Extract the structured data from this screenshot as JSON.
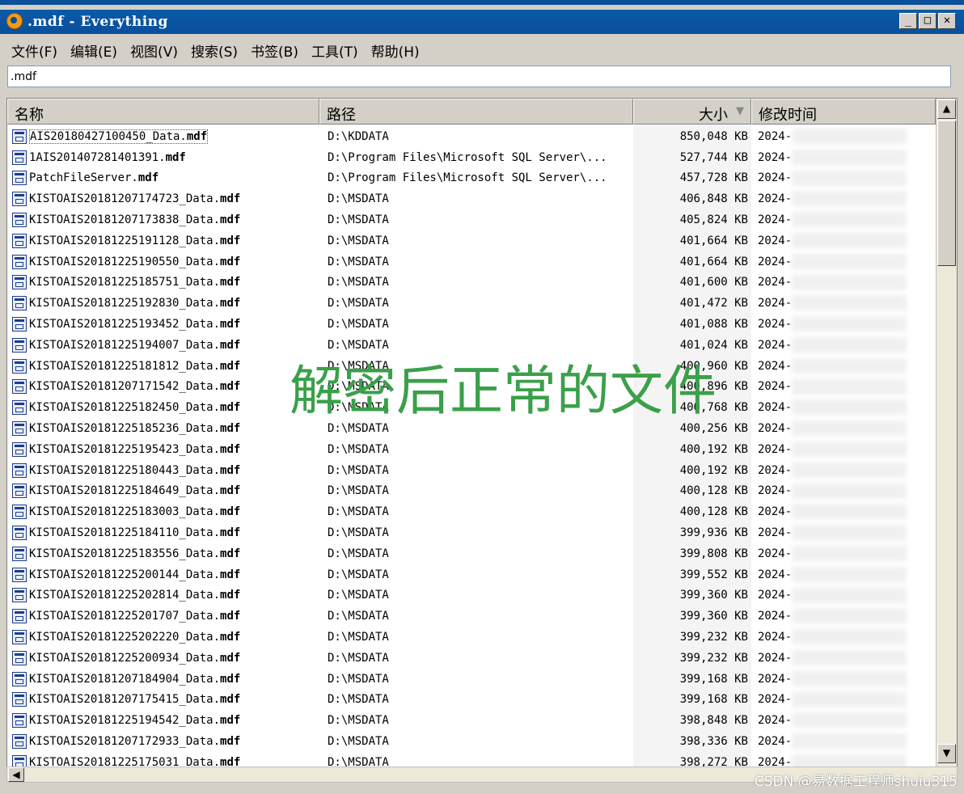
{
  "window": {
    "title": ".mdf - Everything",
    "buttons": {
      "minimize": "_",
      "maximize": "□",
      "close": "✕"
    }
  },
  "menu": [
    "文件(F)",
    "编辑(E)",
    "视图(V)",
    "搜索(S)",
    "书签(B)",
    "工具(T)",
    "帮助(H)"
  ],
  "search": {
    "value": ".mdf"
  },
  "columns": {
    "name": "名称",
    "path": "路径",
    "size": "大小",
    "modified": "修改时间"
  },
  "rows": [
    {
      "base": "AIS20180427100450_Data.",
      "ext": "mdf",
      "path": "D:\\KDDATA",
      "size": "850,048 KB",
      "date": "2024-"
    },
    {
      "base": "1AIS201407281401391.",
      "ext": "mdf",
      "path": "D:\\Program Files\\Microsoft SQL Server\\...",
      "size": "527,744 KB",
      "date": "2024-"
    },
    {
      "base": "PatchFileServer.",
      "ext": "mdf",
      "path": "D:\\Program Files\\Microsoft SQL Server\\...",
      "size": "457,728 KB",
      "date": "2024-"
    },
    {
      "base": "KISTOAIS20181207174723_Data.",
      "ext": "mdf",
      "path": "D:\\MSDATA",
      "size": "406,848 KB",
      "date": "2024-"
    },
    {
      "base": "KISTOAIS20181207173838_Data.",
      "ext": "mdf",
      "path": "D:\\MSDATA",
      "size": "405,824 KB",
      "date": "2024-"
    },
    {
      "base": "KISTOAIS20181225191128_Data.",
      "ext": "mdf",
      "path": "D:\\MSDATA",
      "size": "401,664 KB",
      "date": "2024-"
    },
    {
      "base": "KISTOAIS20181225190550_Data.",
      "ext": "mdf",
      "path": "D:\\MSDATA",
      "size": "401,664 KB",
      "date": "2024-"
    },
    {
      "base": "KISTOAIS20181225185751_Data.",
      "ext": "mdf",
      "path": "D:\\MSDATA",
      "size": "401,600 KB",
      "date": "2024-"
    },
    {
      "base": "KISTOAIS20181225192830_Data.",
      "ext": "mdf",
      "path": "D:\\MSDATA",
      "size": "401,472 KB",
      "date": "2024-"
    },
    {
      "base": "KISTOAIS20181225193452_Data.",
      "ext": "mdf",
      "path": "D:\\MSDATA",
      "size": "401,088 KB",
      "date": "2024-"
    },
    {
      "base": "KISTOAIS20181225194007_Data.",
      "ext": "mdf",
      "path": "D:\\MSDATA",
      "size": "401,024 KB",
      "date": "2024-"
    },
    {
      "base": "KISTOAIS20181225181812_Data.",
      "ext": "mdf",
      "path": "D:\\MSDATA",
      "size": "400,960 KB",
      "date": "2024-"
    },
    {
      "base": "KISTOAIS20181207171542_Data.",
      "ext": "mdf",
      "path": "D:\\MSDATA",
      "size": "400,896 KB",
      "date": "2024-"
    },
    {
      "base": "KISTOAIS20181225182450_Data.",
      "ext": "mdf",
      "path": "D:\\MSDATA",
      "size": "400,768 KB",
      "date": "2024-"
    },
    {
      "base": "KISTOAIS20181225185236_Data.",
      "ext": "mdf",
      "path": "D:\\MSDATA",
      "size": "400,256 KB",
      "date": "2024-"
    },
    {
      "base": "KISTOAIS20181225195423_Data.",
      "ext": "mdf",
      "path": "D:\\MSDATA",
      "size": "400,192 KB",
      "date": "2024-"
    },
    {
      "base": "KISTOAIS20181225180443_Data.",
      "ext": "mdf",
      "path": "D:\\MSDATA",
      "size": "400,192 KB",
      "date": "2024-"
    },
    {
      "base": "KISTOAIS20181225184649_Data.",
      "ext": "mdf",
      "path": "D:\\MSDATA",
      "size": "400,128 KB",
      "date": "2024-"
    },
    {
      "base": "KISTOAIS20181225183003_Data.",
      "ext": "mdf",
      "path": "D:\\MSDATA",
      "size": "400,128 KB",
      "date": "2024-"
    },
    {
      "base": "KISTOAIS20181225184110_Data.",
      "ext": "mdf",
      "path": "D:\\MSDATA",
      "size": "399,936 KB",
      "date": "2024-"
    },
    {
      "base": "KISTOAIS20181225183556_Data.",
      "ext": "mdf",
      "path": "D:\\MSDATA",
      "size": "399,808 KB",
      "date": "2024-"
    },
    {
      "base": "KISTOAIS20181225200144_Data.",
      "ext": "mdf",
      "path": "D:\\MSDATA",
      "size": "399,552 KB",
      "date": "2024-"
    },
    {
      "base": "KISTOAIS20181225202814_Data.",
      "ext": "mdf",
      "path": "D:\\MSDATA",
      "size": "399,360 KB",
      "date": "2024-"
    },
    {
      "base": "KISTOAIS20181225201707_Data.",
      "ext": "mdf",
      "path": "D:\\MSDATA",
      "size": "399,360 KB",
      "date": "2024-"
    },
    {
      "base": "KISTOAIS20181225202220_Data.",
      "ext": "mdf",
      "path": "D:\\MSDATA",
      "size": "399,232 KB",
      "date": "2024-"
    },
    {
      "base": "KISTOAIS20181225200934_Data.",
      "ext": "mdf",
      "path": "D:\\MSDATA",
      "size": "399,232 KB",
      "date": "2024-"
    },
    {
      "base": "KISTOAIS20181207184904_Data.",
      "ext": "mdf",
      "path": "D:\\MSDATA",
      "size": "399,168 KB",
      "date": "2024-"
    },
    {
      "base": "KISTOAIS20181207175415_Data.",
      "ext": "mdf",
      "path": "D:\\MSDATA",
      "size": "399,168 KB",
      "date": "2024-"
    },
    {
      "base": "KISTOAIS20181225194542_Data.",
      "ext": "mdf",
      "path": "D:\\MSDATA",
      "size": "398,848 KB",
      "date": "2024-"
    },
    {
      "base": "KISTOAIS20181207172933_Data.",
      "ext": "mdf",
      "path": "D:\\MSDATA",
      "size": "398,336 KB",
      "date": "2024-"
    },
    {
      "base": "KISTOAIS20181225175031_Data.",
      "ext": "mdf",
      "path": "D:\\MSDATA",
      "size": "398,272 KB",
      "date": "2024-"
    }
  ],
  "overlay_text": "解密后正常的文件",
  "watermark": "CSDN @易数据工程师shuju315"
}
